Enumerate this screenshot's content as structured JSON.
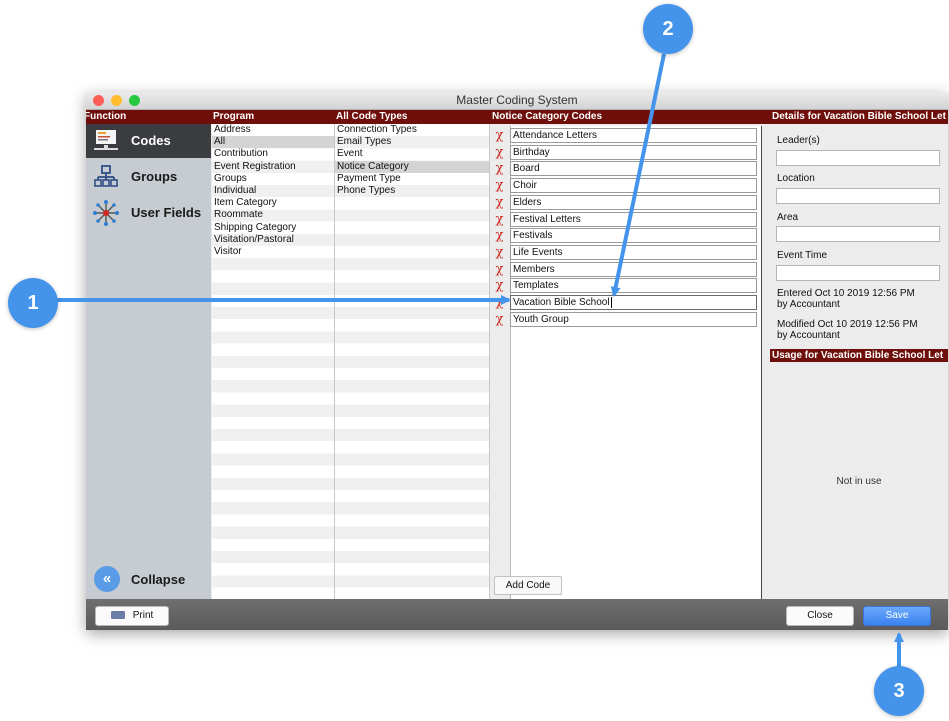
{
  "window": {
    "title": "Master Coding System"
  },
  "headers": {
    "function": "Function",
    "program": "Program",
    "code_types": "All Code Types",
    "codes": "Notice Category Codes",
    "details": "Details for Vacation Bible School Let"
  },
  "sidebar": {
    "items": [
      {
        "label": "Codes",
        "icon": "codes-icon",
        "active": true
      },
      {
        "label": "Groups",
        "icon": "groups-icon",
        "active": false
      },
      {
        "label": "User Fields",
        "icon": "user-fields-icon",
        "active": false
      }
    ],
    "collapse_label": "Collapse"
  },
  "program": {
    "items": [
      "Address",
      "All",
      "Contribution",
      "Event Registration",
      "Groups",
      "Individual",
      "Item Category",
      "Roommate",
      "Shipping Category",
      "Visitation/Pastoral",
      "Visitor"
    ],
    "selected": "All"
  },
  "code_types": {
    "items": [
      "Connection Types",
      "Email Types",
      "Event",
      "Notice Category",
      "Payment Type",
      "Phone Types"
    ],
    "selected": "Notice Category"
  },
  "codes": {
    "items": [
      "Attendance Letters",
      "Birthday",
      "Board",
      "Choir",
      "Elders",
      "Festival Letters",
      "Festivals",
      "Life Events",
      "Members",
      "Templates",
      "Vacation Bible School",
      "Youth Group"
    ],
    "editing": "Vacation Bible School",
    "delete_glyph": "χ",
    "add_label": "Add Code"
  },
  "details": {
    "leader_label": "Leader(s)",
    "location_label": "Location",
    "area_label": "Area",
    "event_time_label": "Event Time",
    "entered": "Entered Oct 10 2019 12:56 PM",
    "entered_by": "by Accountant",
    "modified": "Modified Oct 10 2019 12:56 PM",
    "modified_by": "by Accountant",
    "usage_header": "Usage for Vacation Bible School Let",
    "usage_status": "Not in use"
  },
  "bottom": {
    "print_label": "Print",
    "close_label": "Close",
    "save_label": "Save"
  },
  "callouts": {
    "one": "1",
    "two": "2",
    "three": "3"
  },
  "colors": {
    "accent": "#4394ea",
    "header": "#6e0f0b",
    "delete": "#d0281e"
  }
}
